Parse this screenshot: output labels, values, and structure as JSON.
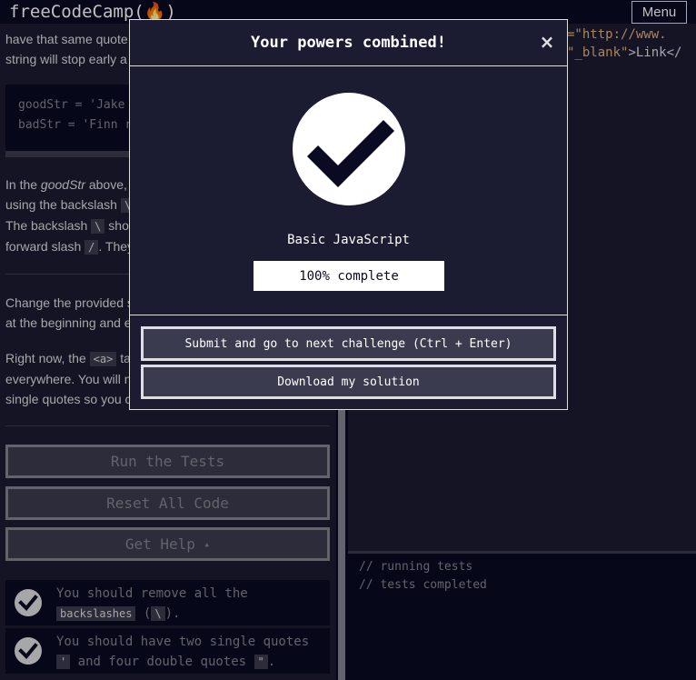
{
  "nav": {
    "logo_text": "freeCodeCamp",
    "logo_flame": "(🔥)",
    "menu_label": "Menu"
  },
  "instructions": {
    "para1_line1": "have that same quote",
    "para1_line2": "string will stop early a",
    "code_line1": "goodStr = 'Jake a",
    "code_line2": "badStr = 'Finn re",
    "para2_l1_a": "In the ",
    "para2_l1_em": "goodStr",
    "para2_l1_b": " above, y",
    "para2_l2_a": "using the backslash ",
    "para2_l2_code": "\\",
    "para2_l3_a": "The backslash ",
    "para2_l3_code": "\\",
    "para2_l3_b": " shou",
    "para2_l4_a": "forward slash ",
    "para2_l4_code": "/",
    "para2_l4_b": ". They",
    "para3_line1": "Change the provided s",
    "para3_line2": "at the beginning and e",
    "para4_l1_a": "Right now, the ",
    "para4_l1_code": "<a>",
    "para4_l1_b": " ta",
    "para4_line2": "everywhere. You will n",
    "para4_line3": "single quotes so you c"
  },
  "buttons": {
    "run_tests": "Run the Tests",
    "reset_code": "Reset All Code",
    "get_help": "Get Help",
    "get_help_caret": "▴"
  },
  "tests": [
    {
      "line1": "You should remove all the",
      "line2_code": "backslashes",
      "line2_mid": " (",
      "line2_code2": "\\",
      "line2_end": ")."
    },
    {
      "line1": "You should have two single quotes",
      "line2_code": "'",
      "line2_mid": " and four double quotes ",
      "line2_code2": "\"",
      "line2_end": "."
    }
  ],
  "editor": {
    "line1": "=\"http://www.",
    "line2_a": "\"_blank\"",
    "line2_b": ">Link</"
  },
  "console": {
    "line1": "// running tests",
    "line2": "// tests completed"
  },
  "modal": {
    "title": "Your powers combined!",
    "close_glyph": "×",
    "cert_name": "Basic JavaScript",
    "progress_text": "100% complete",
    "progress_fraction": 1.0,
    "submit_label": "Submit and go to next challenge (Ctrl + Enter)",
    "download_label": "Download my solution"
  },
  "colors": {
    "bg_dark": "#0a0a23",
    "bg_panel": "#1b1b32",
    "gray": "#3b3b4f",
    "string_orange": "#e8b07a"
  }
}
